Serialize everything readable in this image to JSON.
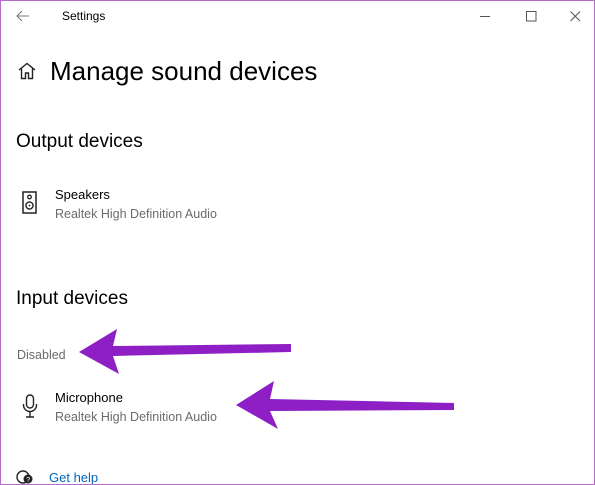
{
  "window": {
    "app_title": "Settings"
  },
  "page": {
    "title": "Manage sound devices"
  },
  "output_section": {
    "title": "Output devices",
    "devices": [
      {
        "name": "Speakers",
        "description": "Realtek High Definition Audio",
        "icon": "speaker-icon"
      }
    ]
  },
  "input_section": {
    "title": "Input devices",
    "disabled_label": "Disabled",
    "devices": [
      {
        "name": "Microphone",
        "description": "Realtek High Definition Audio",
        "icon": "microphone-icon"
      }
    ]
  },
  "footer": {
    "help_link": "Get help"
  },
  "colors": {
    "accent_link": "#0067c0",
    "annotation_arrow": "#8e1fc4",
    "window_border": "#b56bc9",
    "secondary_text": "#6b6b6b"
  }
}
